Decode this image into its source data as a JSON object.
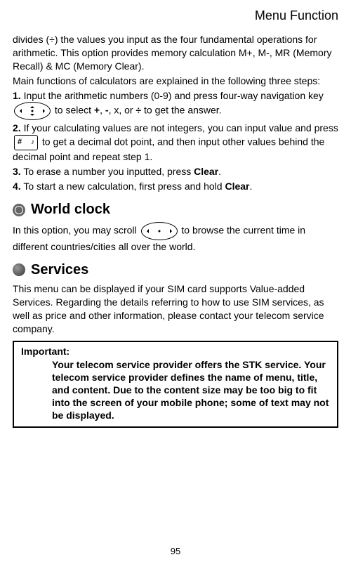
{
  "header": {
    "title": "Menu Function"
  },
  "intro": {
    "p1a": "divides (÷) the values you input as the four fundamental operations for arithmetic. This option provides memory calculation M+, M-, MR (Memory Recall) & MC (Memory Clear).",
    "p1b": "Main functions of calculators are explained in the following three steps:",
    "s1a": "1.",
    "s1b": " Input the arithmetic numbers (0-9) and press four-way navigation key ",
    "s1c": " to select ",
    "op_plus": "+",
    "s1d": ", ",
    "op_minus": "-",
    "s1e": ", x, or  ",
    "op_div": "÷",
    "s1f": " to get the answer.",
    "s2a": "2.",
    "s2b": " If your calculating values are not integers, you can input value and press ",
    "s2c": " to get a decimal dot point, and then input other values behind the decimal point and repeat step 1.",
    "s3a": "3.",
    "s3b": " To erase a number you inputted, press ",
    "s3clear": "Clear",
    "s3c": ".",
    "s4a": "4.",
    "s4b": " To start a new calculation, first press and hold ",
    "s4clear": "Clear",
    "s4c": "."
  },
  "worldclock": {
    "title": "World clock",
    "p1a": "In this option, you may scroll ",
    "p1b": " to browse the current time in different countries/cities all over the world."
  },
  "services": {
    "title": "Services",
    "p1": "This menu can be displayed if your SIM card supports Value-added Services. Regarding the details referring to how to use SIM services, as well as price and other information, please contact your telecom service company.",
    "notice_label": "Important:",
    "notice_body": "Your telecom service provider offers the STK service. Your telecom service provider defines the name of menu, title, and content. Due to the content size may be too big to fit into the screen of your mobile phone; some of text may not be displayed."
  },
  "page_number": "95"
}
